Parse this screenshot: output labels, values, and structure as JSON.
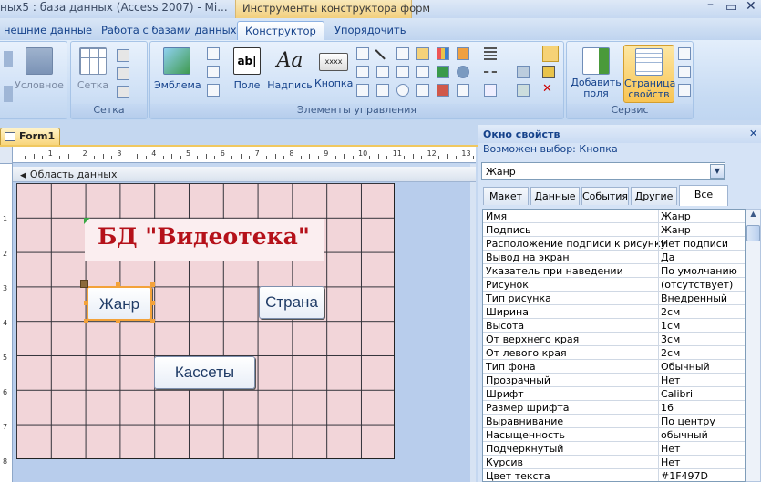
{
  "window": {
    "title": "ных5 : база данных (Access 2007) - Mi...",
    "context_title": "Инструменты конструктора форм"
  },
  "tabs": [
    "нешние данные",
    "Работа с базами данных",
    "Конструктор",
    "Упорядочить"
  ],
  "ribbon": {
    "groups": {
      "grid": "Сетка",
      "controls": "Элементы управления",
      "service": "Сервис"
    },
    "buttons": {
      "conditional": "Условное",
      "grid": "Сетка",
      "emblem": "Эмблема",
      "field": "Поле",
      "label": "Надпись",
      "button": "Кнопка",
      "add_field_1": "Добавить",
      "add_field_2": "поля",
      "property_sheet_1": "Страница",
      "property_sheet_2": "свойств"
    },
    "label_icon_text": "Aa",
    "textbox_icon_text": "ab|",
    "button_icon_text": "xxxx"
  },
  "document": {
    "tab": "Form1",
    "section": "Область данных",
    "ruler_h": [
      "1",
      "2",
      "3",
      "4",
      "5",
      "6",
      "7",
      "8",
      "9",
      "10",
      "11",
      "12",
      "13"
    ],
    "ruler_v": [
      "1",
      "2",
      "3",
      "4",
      "5",
      "6",
      "7",
      "8"
    ]
  },
  "form": {
    "title_label": "БД \"Видеотека\"",
    "button_genre": "Жанр",
    "button_country": "Страна",
    "button_cassettes": "Кассеты"
  },
  "property_sheet": {
    "title": "Окно свойств",
    "selection_type": "Возможен выбор:  Кнопка",
    "selected_object": "Жанр",
    "tabs": [
      "Макет",
      "Данные",
      "События",
      "Другие",
      "Все"
    ],
    "active_tab": "Все",
    "properties": [
      {
        "name": "Имя",
        "value": "Жанр"
      },
      {
        "name": "Подпись",
        "value": "Жанр"
      },
      {
        "name": "Расположение подписи к рисунку",
        "value": "Нет подписи"
      },
      {
        "name": "Вывод на экран",
        "value": "Да"
      },
      {
        "name": "Указатель при наведении",
        "value": "По умолчанию"
      },
      {
        "name": "Рисунок",
        "value": "(отсутствует)"
      },
      {
        "name": "Тип рисунка",
        "value": "Внедренный"
      },
      {
        "name": "Ширина",
        "value": "2см"
      },
      {
        "name": "Высота",
        "value": "1см"
      },
      {
        "name": "От верхнего края",
        "value": "3см"
      },
      {
        "name": "От левого края",
        "value": "2см"
      },
      {
        "name": "Тип фона",
        "value": "Обычный"
      },
      {
        "name": "Прозрачный",
        "value": "Нет"
      },
      {
        "name": "Шрифт",
        "value": "Calibri"
      },
      {
        "name": "Размер шрифта",
        "value": "16"
      },
      {
        "name": "Выравнивание",
        "value": "По центру"
      },
      {
        "name": "Насыщенность",
        "value": "обычный"
      },
      {
        "name": "Подчеркнутый",
        "value": "Нет"
      },
      {
        "name": "Курсив",
        "value": "Нет"
      },
      {
        "name": "Цвет текста",
        "value": "#1F497D"
      }
    ]
  },
  "colors": {
    "title_text": "#b5111a",
    "grid_bg": "#f2d5d9",
    "selection": "#f3a23a"
  }
}
